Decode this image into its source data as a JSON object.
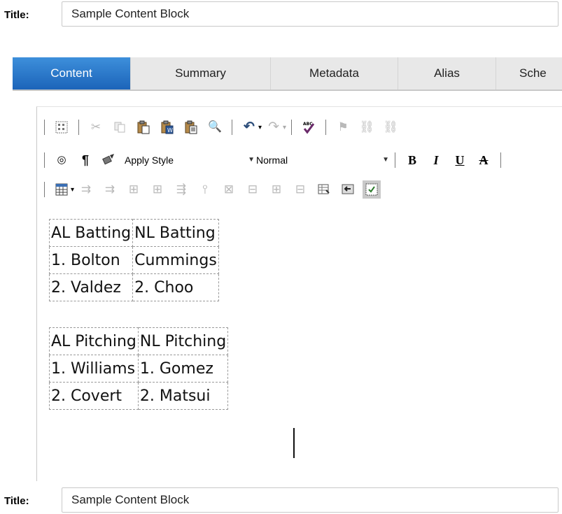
{
  "title_label": "Title:",
  "title_value": "Sample Content Block",
  "tabs": [
    {
      "label": "Content",
      "active": true
    },
    {
      "label": "Summary"
    },
    {
      "label": "Metadata"
    },
    {
      "label": "Alias"
    },
    {
      "label": "Sche"
    }
  ],
  "toolbar": {
    "row1": [
      "select-all-icon",
      "cut-icon",
      "copy-icon",
      "paste-icon",
      "paste-from-word-icon",
      "paste-plain-text-icon",
      "find-replace-icon",
      "undo-icon",
      "redo-icon",
      "spell-check-icon",
      "insert-link-icon",
      "hyperlink-icon",
      "remove-link-icon"
    ],
    "row2": {
      "icons": [
        "target-icon",
        "paragraph-icon",
        "format-painter-icon"
      ],
      "style_select": "Apply Style",
      "paragraph_select": "Normal",
      "bold": "B",
      "italic": "I",
      "underline": "U",
      "strikethrough": "A"
    },
    "row3": [
      "insert-table-icon",
      "insert-row-above-icon",
      "insert-row-below-icon",
      "insert-column-left-icon",
      "insert-column-right-icon",
      "insert-column-icon",
      "split-cell-icon",
      "delete-row-icon",
      "delete-column-icon",
      "merge-cells-icon",
      "cell-properties-icon",
      "table-properties-icon",
      "delete-table-icon",
      "toggle-table-borders-icon"
    ]
  },
  "tables": {
    "batting": [
      [
        "AL Batting",
        "NL Batting"
      ],
      [
        "1. Bolton",
        "Cummings"
      ],
      [
        "2. Valdez",
        "2. Choo"
      ]
    ],
    "pitching": [
      [
        "AL Pitching",
        "NL Pitching"
      ],
      [
        "1. Williams",
        "1. Gomez"
      ],
      [
        "2. Covert",
        "2. Matsui"
      ]
    ]
  }
}
